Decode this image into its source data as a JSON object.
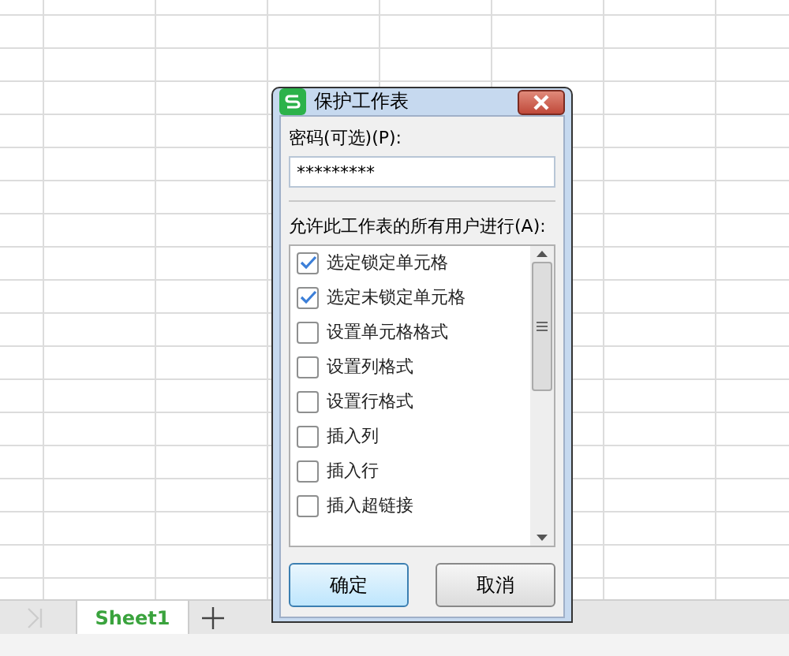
{
  "sheet_tabs": [
    {
      "label": "Sheet1",
      "selected": true
    }
  ],
  "dialog": {
    "title": "保护工作表",
    "password_label": "密码(可选)(P):",
    "password_value": "*********",
    "permissions_label": "允许此工作表的所有用户进行(A):",
    "permissions": [
      {
        "label": "选定锁定单元格",
        "checked": true
      },
      {
        "label": "选定未锁定单元格",
        "checked": true
      },
      {
        "label": "设置单元格格式",
        "checked": false
      },
      {
        "label": "设置列格式",
        "checked": false
      },
      {
        "label": "设置行格式",
        "checked": false
      },
      {
        "label": "插入列",
        "checked": false
      },
      {
        "label": "插入行",
        "checked": false
      },
      {
        "label": "插入超链接",
        "checked": false
      }
    ],
    "buttons": [
      {
        "label": "确定",
        "kind": "primary"
      },
      {
        "label": "取消",
        "kind": "secondary"
      }
    ]
  }
}
